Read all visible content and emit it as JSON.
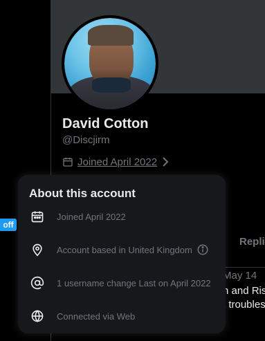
{
  "profile": {
    "name": "David Cotton",
    "handle": "@Discjirm",
    "joined": "Joined April 2022"
  },
  "tabs": {
    "replies": "Replie"
  },
  "post": {
    "date": "May 14",
    "line1": "n and Ris",
    "line2": "t troubles"
  },
  "badge": {
    "off": "off"
  },
  "popup": {
    "title": "About this account",
    "rows": [
      {
        "icon": "calendar-icon",
        "text": "Joined April 2022"
      },
      {
        "icon": "location-pin-icon",
        "text": "Account based in United Kingdom"
      },
      {
        "icon": "at-sign-icon",
        "text": "1 username change Last on April 2022"
      },
      {
        "icon": "globe-icon",
        "text": "Connected via Web"
      }
    ]
  },
  "colors": {
    "background": "#000000",
    "popup": "#16181c",
    "text_primary": "#e7e9ea",
    "text_secondary": "#71767b",
    "accent": "#1d9bf0"
  }
}
